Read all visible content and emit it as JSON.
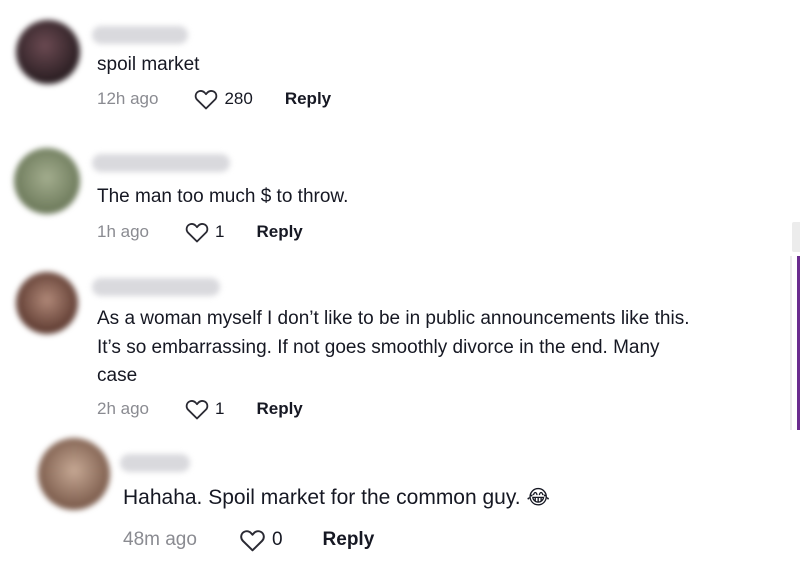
{
  "comments": [
    {
      "text": "spoil market",
      "time": "12h ago",
      "likes": "280",
      "reply_label": "Reply",
      "avatar_color": "#3a2a2e"
    },
    {
      "text": "The man too much $ to throw.",
      "time": "1h ago",
      "likes": "1",
      "reply_label": "Reply",
      "avatar_color": "#7d8a6a"
    },
    {
      "text": "As a woman myself I don’t like to be in public announcements like this. It’s so embarrassing. If not goes smoothly divorce in the end. Many case",
      "time": "2h ago",
      "likes": "1",
      "reply_label": "Reply",
      "avatar_color": "#6e4a3c"
    },
    {
      "text": "Hahaha. Spoil market for the common guy.",
      "emoji": "😂",
      "time": "48m ago",
      "likes": "0",
      "reply_label": "Reply",
      "avatar_color": "#8a6a58"
    }
  ],
  "icons": {
    "like": "heart-outline-icon"
  },
  "colors": {
    "text": "#161823",
    "meta": "#8a8b91",
    "accent": "#6a2c8f"
  }
}
